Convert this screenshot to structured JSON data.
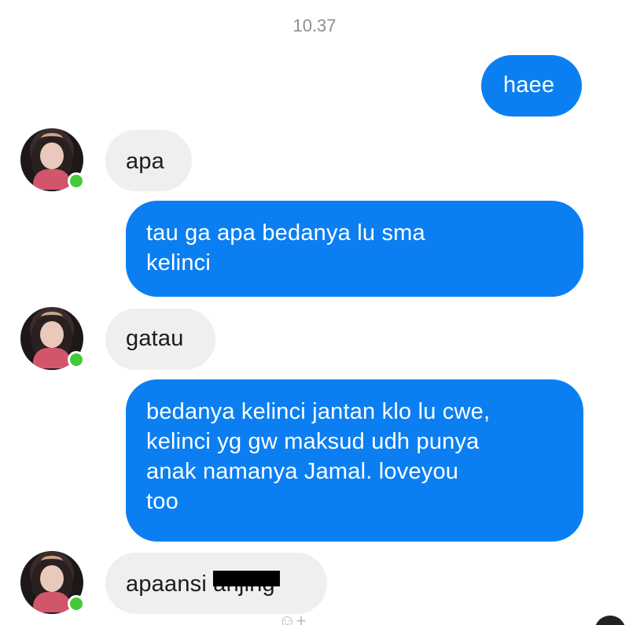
{
  "timestamp": "10.37",
  "messages": [
    {
      "direction": "out",
      "text": "haee"
    },
    {
      "direction": "in",
      "text": "apa"
    },
    {
      "direction": "out",
      "lines": [
        "tau ga apa bedanya lu sma",
        "kelinci"
      ]
    },
    {
      "direction": "in",
      "text": "gatau"
    },
    {
      "direction": "out",
      "lines": [
        "bedanya kelinci jantan klo lu cwe,",
        "kelinci yg gw maksud udh punya",
        "anak namanya Jamal.  loveyou",
        "too"
      ]
    },
    {
      "direction": "in",
      "text": "apaansi",
      "redacted_text": "anjing"
    }
  ],
  "colors": {
    "outgoing_bubble": "#0b7ff2",
    "incoming_bubble": "#efefef",
    "online_indicator": "#45c93a"
  },
  "icons": {
    "emoji_add": "emoji-add-icon"
  }
}
